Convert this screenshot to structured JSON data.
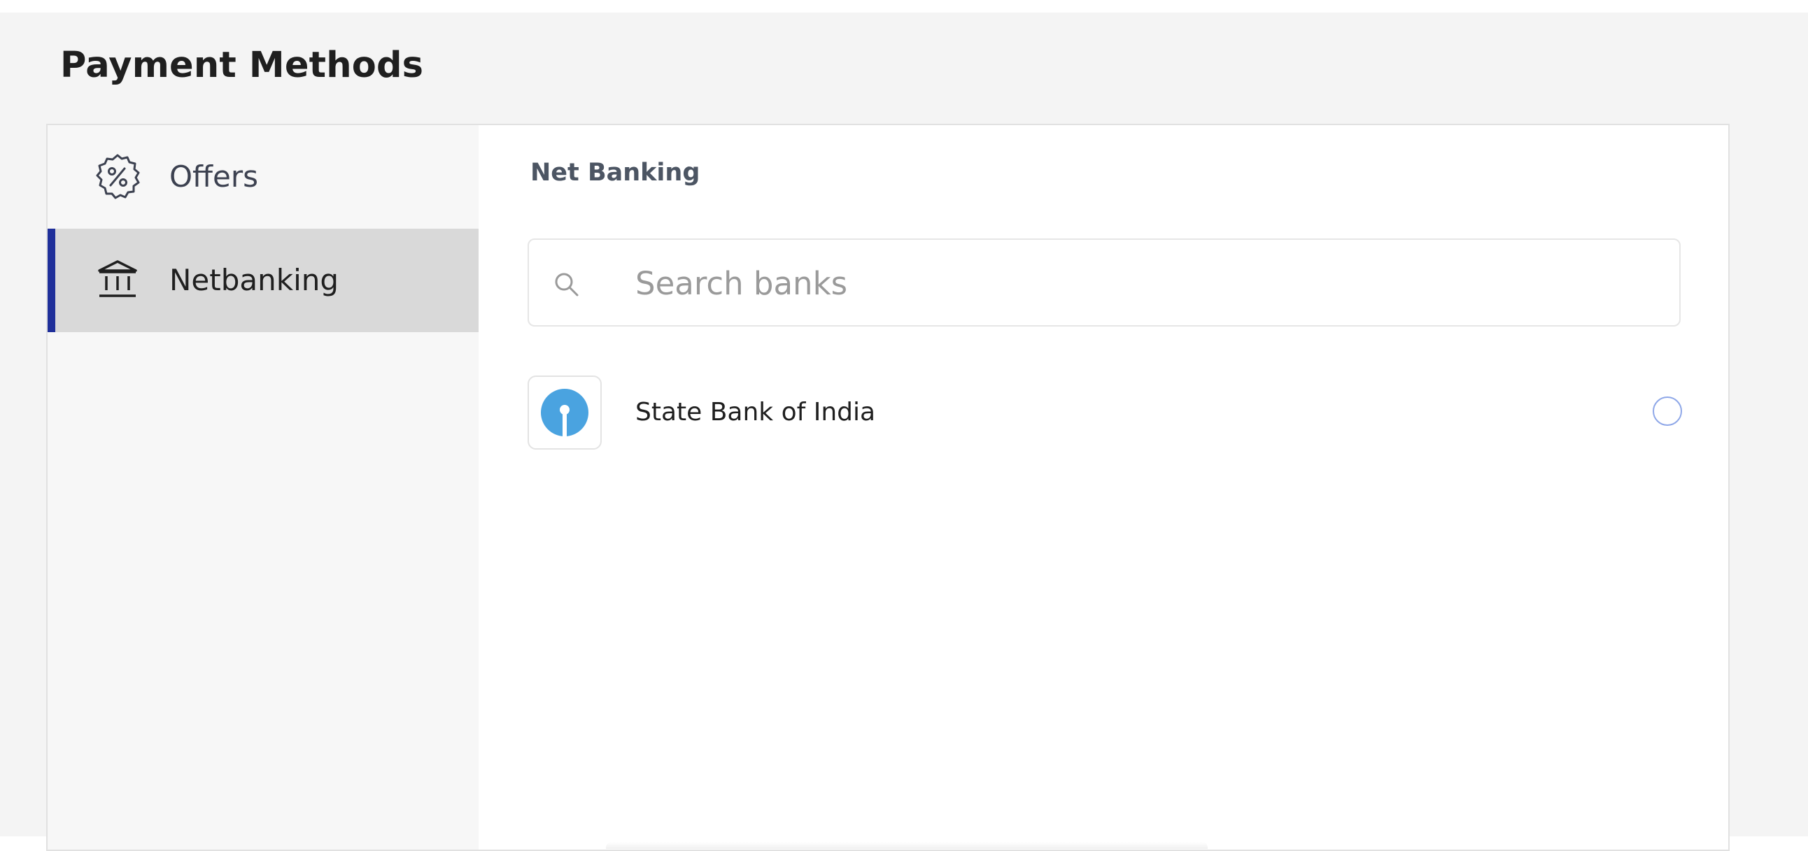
{
  "page": {
    "title": "Payment Methods"
  },
  "sidebar": {
    "items": [
      {
        "label": "Offers",
        "icon": "discount-badge-icon",
        "active": false
      },
      {
        "label": "Netbanking",
        "icon": "bank-icon",
        "active": true
      }
    ],
    "active_color": "#1f2f9a"
  },
  "content": {
    "section_title": "Net Banking",
    "search": {
      "placeholder": "Search banks",
      "value": ""
    },
    "banks": [
      {
        "name": "State Bank of India",
        "logo": "sbi-logo-icon",
        "logo_color": "#4aa3e0",
        "selected": false
      }
    ]
  }
}
